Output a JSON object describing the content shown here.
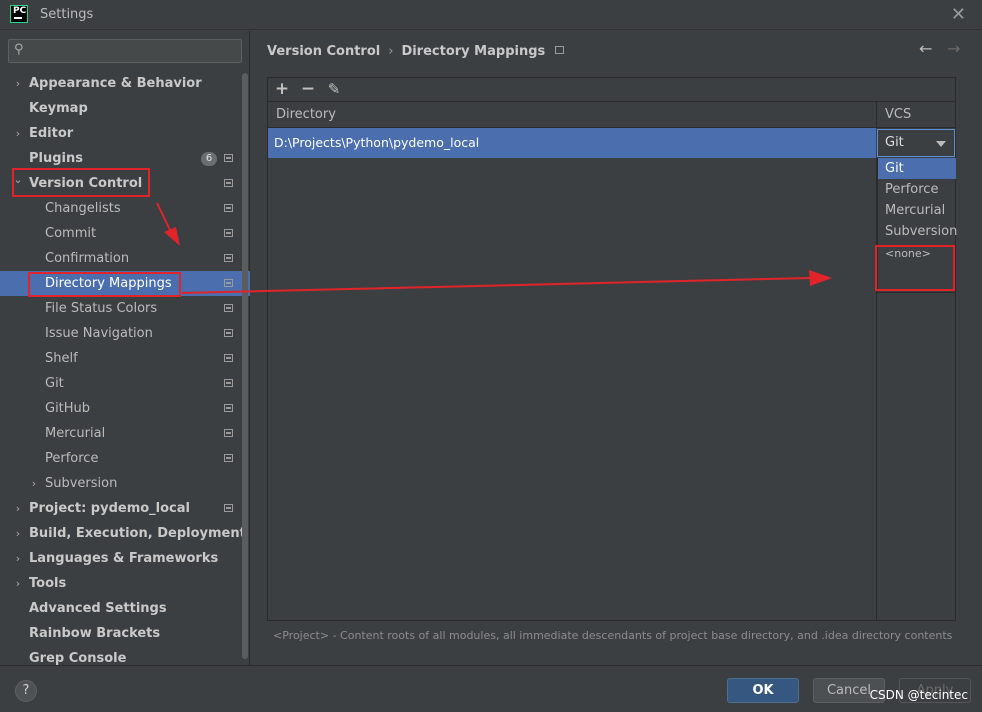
{
  "window": {
    "logo_text": "PC",
    "title": "Settings"
  },
  "sidebar": {
    "search_placeholder": "",
    "items": [
      {
        "label": "Appearance & Behavior",
        "level": 0,
        "expand": "collapsed"
      },
      {
        "label": "Keymap",
        "level": 0,
        "expand": "none"
      },
      {
        "label": "Editor",
        "level": 0,
        "expand": "collapsed"
      },
      {
        "label": "Plugins",
        "level": 0,
        "expand": "none",
        "badge": "6"
      },
      {
        "label": "Version Control",
        "level": 0,
        "expand": "expanded"
      },
      {
        "label": "Changelists",
        "level": 1,
        "expand": "none"
      },
      {
        "label": "Commit",
        "level": 1,
        "expand": "none"
      },
      {
        "label": "Confirmation",
        "level": 1,
        "expand": "none"
      },
      {
        "label": "Directory Mappings",
        "level": 1,
        "expand": "none",
        "selected": true
      },
      {
        "label": "File Status Colors",
        "level": 1,
        "expand": "none"
      },
      {
        "label": "Issue Navigation",
        "level": 1,
        "expand": "none"
      },
      {
        "label": "Shelf",
        "level": 1,
        "expand": "none"
      },
      {
        "label": "Git",
        "level": 1,
        "expand": "none"
      },
      {
        "label": "GitHub",
        "level": 1,
        "expand": "none"
      },
      {
        "label": "Mercurial",
        "level": 1,
        "expand": "none"
      },
      {
        "label": "Perforce",
        "level": 1,
        "expand": "none"
      },
      {
        "label": "Subversion",
        "level": 1,
        "expand": "collapsed"
      },
      {
        "label": "Project: pydemo_local",
        "level": 0,
        "expand": "collapsed"
      },
      {
        "label": "Build, Execution, Deployment",
        "level": 0,
        "expand": "collapsed"
      },
      {
        "label": "Languages & Frameworks",
        "level": 0,
        "expand": "collapsed"
      },
      {
        "label": "Tools",
        "level": 0,
        "expand": "collapsed"
      },
      {
        "label": "Advanced Settings",
        "level": 0,
        "expand": "none"
      },
      {
        "label": "Rainbow Brackets",
        "level": 0,
        "expand": "none"
      },
      {
        "label": "Grep Console",
        "level": 0,
        "expand": "none"
      }
    ]
  },
  "breadcrumb": {
    "parent": "Version Control",
    "separator": "›",
    "current": "Directory Mappings"
  },
  "toolbar": {
    "add": "+",
    "remove": "−",
    "edit": "✎"
  },
  "table": {
    "columns": [
      "Directory",
      "VCS"
    ],
    "rows": [
      {
        "directory": "D:\\Projects\\Python\\pydemo_local",
        "vcs": "Git"
      }
    ]
  },
  "vcs_dropdown": {
    "options": [
      "Git",
      "Perforce",
      "Mercurial",
      "Subversion",
      "<none>"
    ],
    "selected": "Git"
  },
  "hint": "<Project> - Content roots of all modules, all immediate descendants of project base directory, and .idea directory contents",
  "buttons": {
    "help": "?",
    "ok": "OK",
    "cancel": "Cancel",
    "apply": "Apply"
  },
  "watermark": "CSDN @tecintec",
  "colors": {
    "selection": "#4b6eaf",
    "annotation": "#e0242a",
    "background": "#3c3f41"
  }
}
